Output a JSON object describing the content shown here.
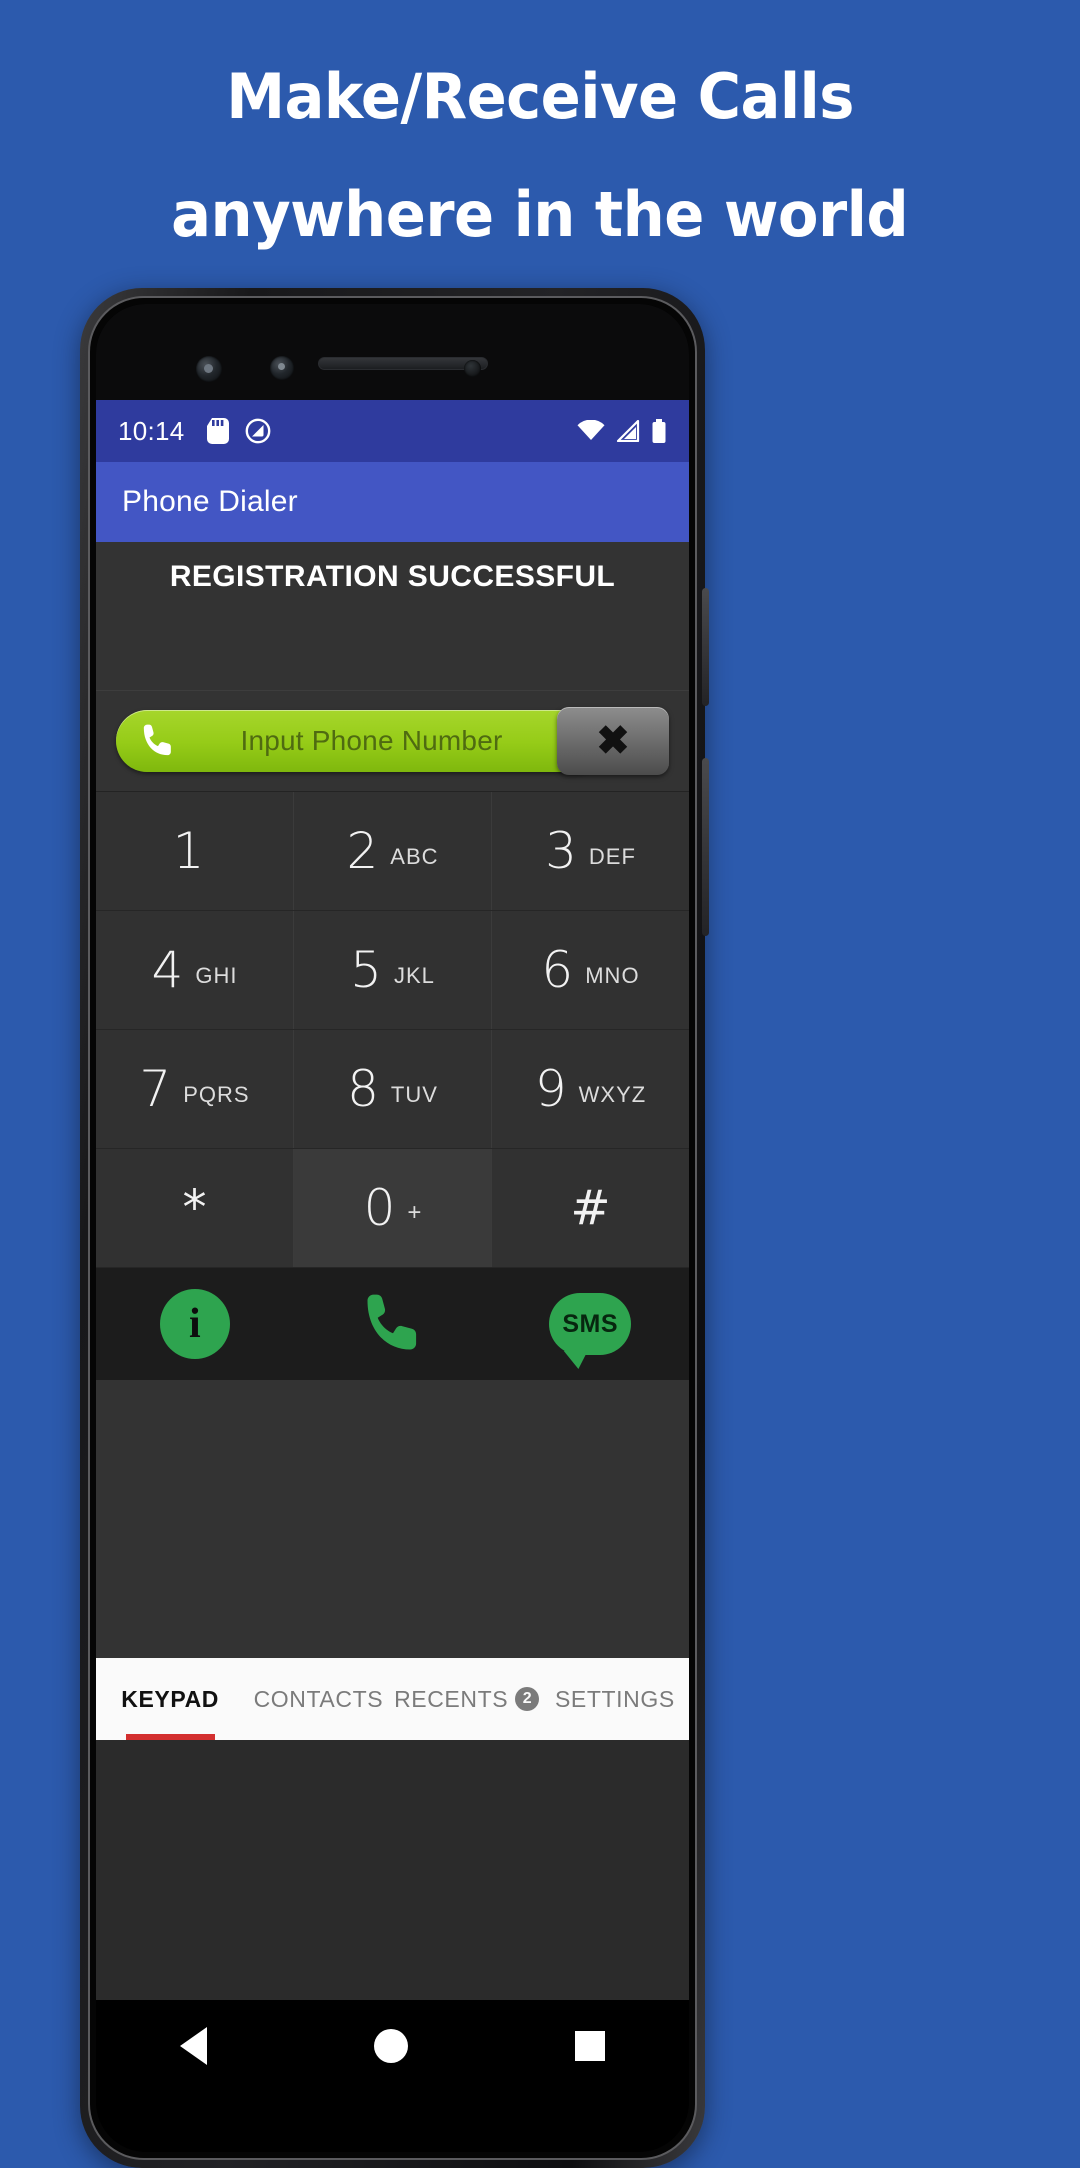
{
  "banner": {
    "line1": "Make/Receive Calls",
    "line2": "anywhere in the world",
    "background_color": "#2c5aad",
    "text_color": "#ffffff"
  },
  "phone": {
    "status_bar": {
      "time": "10:14",
      "left_icons": [
        "sd-card-icon",
        "do-not-disturb-icon"
      ],
      "right_icons": [
        "wifi-icon",
        "signal-icon",
        "battery-icon"
      ],
      "background_color": "#2f3b9e"
    },
    "app_bar": {
      "title": "Phone Dialer",
      "background_color": "#4356c4"
    },
    "registration": {
      "message": "REGISTRATION SUCCESSFUL"
    },
    "input": {
      "placeholder": "Input Phone Number",
      "value": "",
      "leading_icon": "phone-handset-icon",
      "clear_label": "✖",
      "pill_color": "#96cc18"
    },
    "keypad": {
      "rows": [
        [
          {
            "digit": "1",
            "letters": ""
          },
          {
            "digit": "2",
            "letters": "ABC"
          },
          {
            "digit": "3",
            "letters": "DEF"
          }
        ],
        [
          {
            "digit": "4",
            "letters": "GHI"
          },
          {
            "digit": "5",
            "letters": "JKL"
          },
          {
            "digit": "6",
            "letters": "MNO"
          }
        ],
        [
          {
            "digit": "7",
            "letters": "PQRS"
          },
          {
            "digit": "8",
            "letters": "TUV"
          },
          {
            "digit": "9",
            "letters": "WXYZ"
          }
        ],
        [
          {
            "digit": "*",
            "letters": ""
          },
          {
            "digit": "0",
            "letters": "+"
          },
          {
            "digit": "#",
            "letters": ""
          }
        ]
      ]
    },
    "actions": [
      {
        "name": "info-button",
        "icon": "info-circle-icon",
        "label": "i"
      },
      {
        "name": "call-button",
        "icon": "phone-call-icon",
        "label": ""
      },
      {
        "name": "sms-button",
        "icon": "sms-bubble-icon",
        "label": "SMS"
      }
    ],
    "action_color": "#2ea44f",
    "tabs": [
      {
        "label": "KEYPAD",
        "active": true,
        "badge": ""
      },
      {
        "label": "CONTACTS",
        "active": false,
        "badge": ""
      },
      {
        "label": "RECENTS",
        "active": false,
        "badge": "2"
      },
      {
        "label": "SETTINGS",
        "active": false,
        "badge": ""
      }
    ],
    "tab_accent_color": "#d32f2f",
    "nav_bar": {
      "back": "back-triangle-icon",
      "home": "home-circle-icon",
      "recents": "recents-square-icon"
    }
  }
}
